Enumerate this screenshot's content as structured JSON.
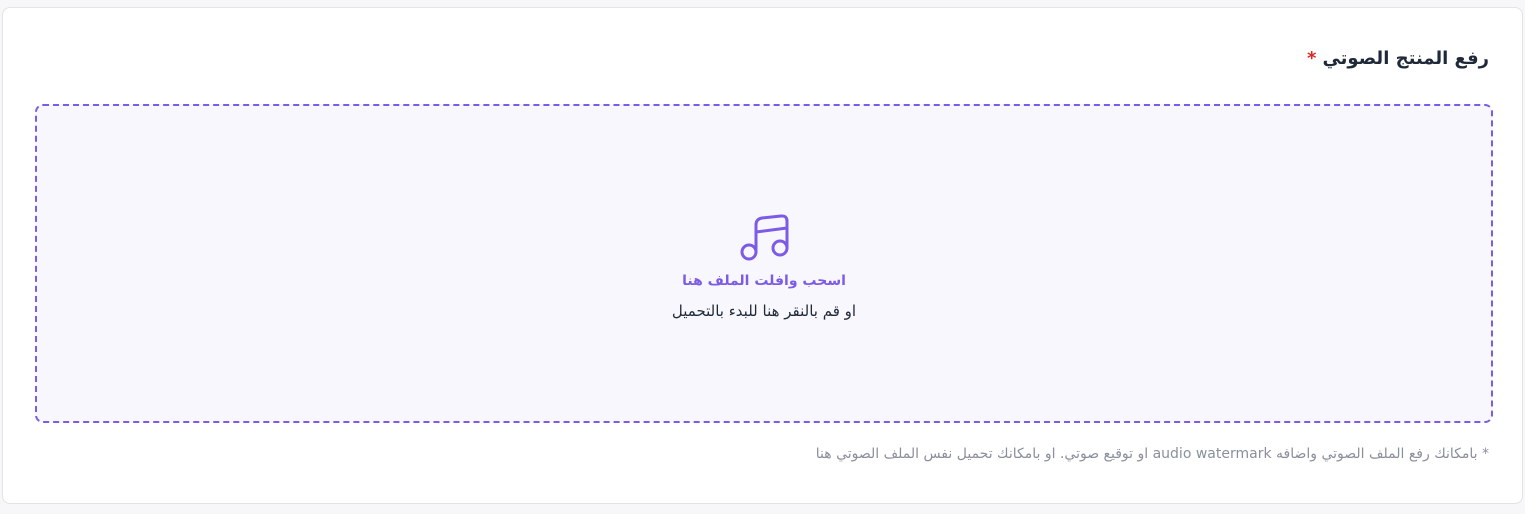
{
  "upload": {
    "title": "رفع المنتج الصوتي",
    "required_marker": "*",
    "dropzone": {
      "icon": "music-note-icon",
      "primary_text": "اسحب وافلت الملف هنا",
      "secondary_text": "او قم بالنقر هنا للبدء بالتحميل"
    },
    "hint": "* بامكانك رفع الملف الصوتي واضافه audio watermark او توقيع صوتي. او بامكانك تحميل نفس الملف الصوتي هنا"
  },
  "colors": {
    "accent": "#7c5ce6",
    "dropzone_bg": "#f8f7fd",
    "required": "#dc2626",
    "hint": "#8a8f9c"
  }
}
